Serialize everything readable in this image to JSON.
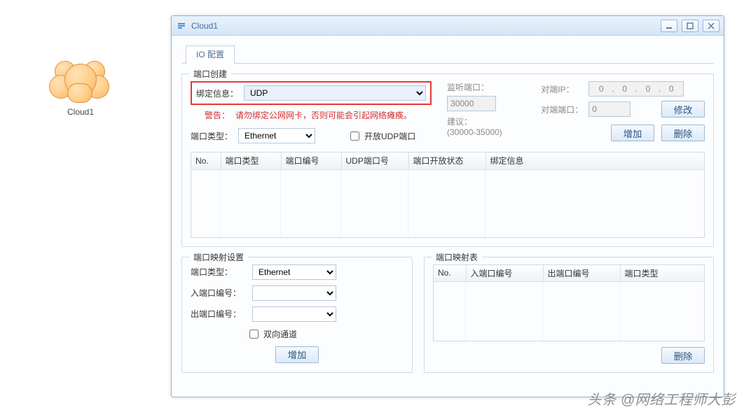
{
  "cloud_node": {
    "label": "Cloud1"
  },
  "window": {
    "title": "Cloud1",
    "buttons": {
      "min": "minimize",
      "max": "maximize",
      "close": "close"
    }
  },
  "tabs": [
    {
      "label": "IO 配置",
      "active": true
    }
  ],
  "port_create": {
    "legend": "端口创建",
    "binding_label": "绑定信息：",
    "binding_value": "UDP",
    "warning_label": "警告：",
    "warning_text": "请勿绑定公网网卡，否则可能会引起网络瘫痪。",
    "port_type_label": "端口类型：",
    "port_type_value": "Ethernet",
    "open_udp_label": "开放UDP端口",
    "open_udp_checked": false,
    "listen_port_label": "监听端口：",
    "listen_port_value": "30000",
    "listen_hint_label": "建议：",
    "listen_hint_range": "(30000-35000)",
    "peer_ip_label": "对端IP：",
    "peer_ip": [
      "0",
      "0",
      "0",
      "0"
    ],
    "peer_port_label": "对端端口：",
    "peer_port_value": "0",
    "btn_modify": "修改",
    "btn_add": "增加",
    "btn_delete": "删除",
    "table_headers": [
      "No.",
      "端口类型",
      "端口编号",
      "UDP端口号",
      "端口开放状态",
      "绑定信息"
    ]
  },
  "mapping_set": {
    "legend": "端口映射设置",
    "port_type_label": "端口类型：",
    "port_type_value": "Ethernet",
    "in_port_label": "入端口编号：",
    "out_port_label": "出端口编号：",
    "bidir_label": "双向通道",
    "bidir_checked": false,
    "btn_add": "增加"
  },
  "mapping_table": {
    "legend": "端口映射表",
    "headers": [
      "No.",
      "入端口编号",
      "出端口编号",
      "端口类型"
    ],
    "btn_delete": "删除"
  },
  "watermark": "头条 @网络工程师大彭"
}
